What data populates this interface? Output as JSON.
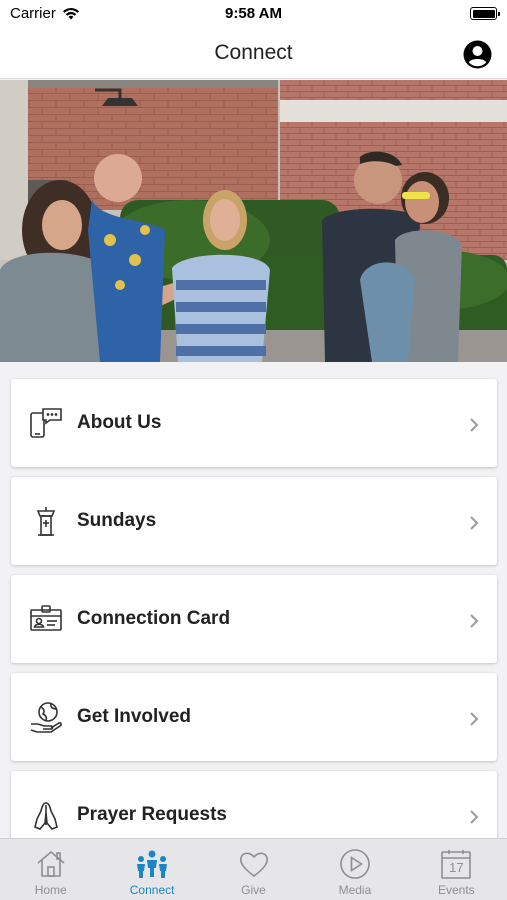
{
  "status_bar": {
    "carrier": "Carrier",
    "time": "9:58 AM",
    "icons": [
      "wifi-icon",
      "battery-icon"
    ]
  },
  "nav": {
    "title": "Connect",
    "profile_icon": "user-circle-icon"
  },
  "hero": {
    "alt": "group photo"
  },
  "menu": {
    "items": [
      {
        "label": "About Us",
        "icon": "phone-chat-icon"
      },
      {
        "label": "Sundays",
        "icon": "pulpit-icon"
      },
      {
        "label": "Connection Card",
        "icon": "id-card-icon"
      },
      {
        "label": "Get Involved",
        "icon": "globe-hand-icon"
      },
      {
        "label": "Prayer Requests",
        "icon": "praying-hands-icon"
      }
    ]
  },
  "tabs": {
    "items": [
      {
        "label": "Home",
        "icon": "home-icon",
        "active": false
      },
      {
        "label": "Connect",
        "icon": "people-icon",
        "active": true
      },
      {
        "label": "Give",
        "icon": "heart-icon",
        "active": false
      },
      {
        "label": "Media",
        "icon": "play-circle-icon",
        "active": false
      },
      {
        "label": "Events",
        "icon": "calendar-icon",
        "active": false
      }
    ],
    "calendar_day": "17"
  },
  "colors": {
    "accent": "#1a86c4",
    "inactive": "#8e8e93",
    "background": "#f2f2f4",
    "tab_bar": "#e6e6e8"
  }
}
